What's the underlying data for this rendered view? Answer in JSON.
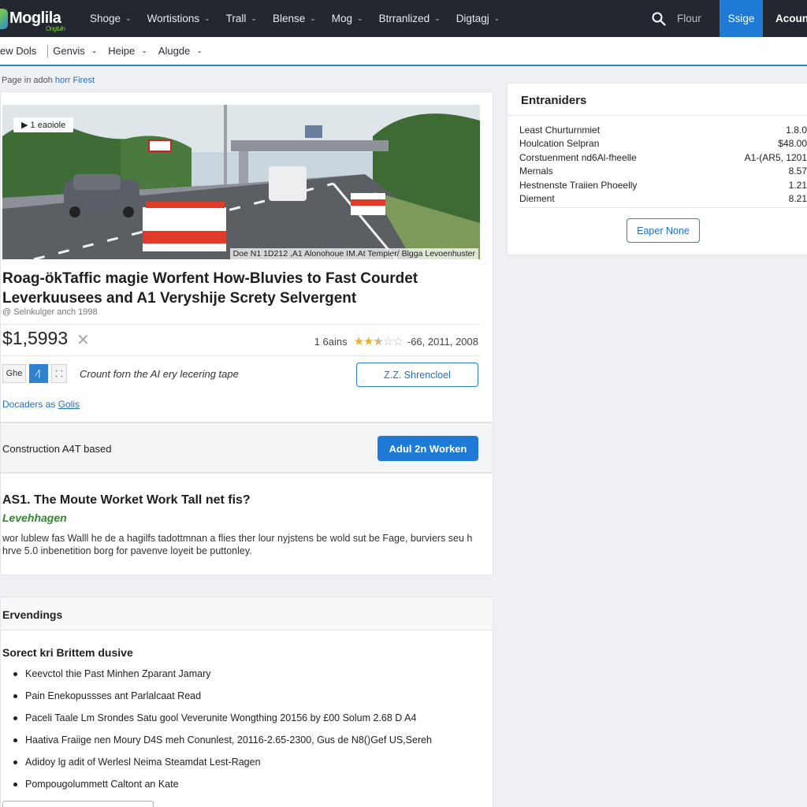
{
  "topbar": {
    "logo": "Moglila",
    "logo_sub": "Ongtuln",
    "nav": [
      {
        "label": "Shoge"
      },
      {
        "label": "Wortistions"
      },
      {
        "label": "Trall"
      },
      {
        "label": "Blense"
      },
      {
        "label": "Mog"
      },
      {
        "label": "Btrranlized"
      },
      {
        "label": "Digtagj"
      }
    ],
    "flour": "Flour",
    "signup": "Ssige",
    "account": "Acount"
  },
  "subbar": {
    "items": [
      "ew Dols",
      "Genvis",
      "Heipe",
      "Alugde"
    ]
  },
  "breadcrumb": {
    "prefix": "Page in adoh ",
    "link": "horr Firest"
  },
  "listing": {
    "play_badge": "1 eaoiole",
    "hero_caption": "Doe N1 1D212 ,A1 Alonohoue IM.At Templer/ Blgga Levoenhuster",
    "title": "Roag-ökTaffic magie Worfent How-Bluvies to Fast Courdet Leverkuusees and A1 Veryshije Screty Selvergent",
    "byline": "@ Selnkulger anch 1998",
    "price": "$1,5993",
    "rating_count": "1 6ains",
    "rating_value": 2.5,
    "rating_date": "-66, 2011, 2008",
    "tool_buttons": [
      "Ghe",
      "⁄|",
      "⸬"
    ],
    "tool_note": "Crount forn the AI ery lecering tape",
    "outline_button": "Z.Z. Shrencloel",
    "doc_link_prefix": "Docaders as ",
    "doc_link": "Golis"
  },
  "band": {
    "label": "Construction A4T based",
    "button": "Adul 2n Worken"
  },
  "qa": {
    "title": "AS1. The Moute Worket Work Tall net fis?",
    "subtitle": "Levehhagen",
    "body": "wor lublew fas Walll he de a hagilfs tadottmnan a flies ther lour nyjstens be wold sut be Fage, burviers seu h hrve 5.0 inbenetition borg for pavenve loyeit be puttonley."
  },
  "events": {
    "header": "Ervendings",
    "subtitle": "Sorect kri Brittem dusive",
    "items": [
      "Keevctol thie Past Minhen Zparant Jamary",
      "Pain Enekopussses ant Parlalcaat Read",
      "Paceli Taale Lm Srondes Satu gool Veverunite Wongthing 20156 by £00 Solum 2.68 D A4",
      "Haativa Fraiige nen Moury D4S meh Conunlest, 20116-2.65-2300, Gus de N8()Gef US,Sereh",
      "Adidoy lg adit of Werlesl Neima Steamdat Lest-Ragen",
      "Pompougolummett Caltont an Kate"
    ]
  },
  "sidebar": {
    "title": "Entraniders",
    "rows": [
      {
        "label": "Least Churturnmiet",
        "value": "1.8.0"
      },
      {
        "label": "Houlcation Selpran",
        "value": "$48.00"
      },
      {
        "label": "Corstuenment nd6Al-fheelle",
        "value": "A1-(AR5, 1201"
      },
      {
        "label": "Mernals",
        "value": "8.57"
      },
      {
        "label": "Hestnenste Traiien Phoeelly",
        "value": "1.21"
      },
      {
        "label": "Diement",
        "value": "8.21"
      }
    ],
    "button": "Eaper None"
  },
  "colors": {
    "accent": "#1f7ad6",
    "topbar": "#232730",
    "star": "#f2b01e",
    "subtitle_green": "#2e8a2e"
  }
}
